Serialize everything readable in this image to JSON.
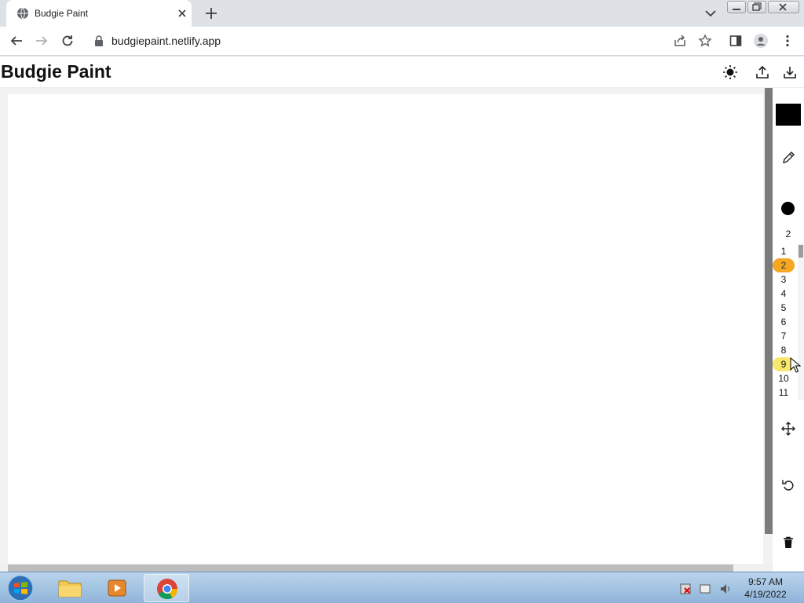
{
  "browser": {
    "tab_title": "Budgie Paint",
    "url": "budgiepaint.netlify.app"
  },
  "app": {
    "title": "Budgie Paint",
    "stroke_color": "#000000",
    "brush_size_value": "2",
    "brush_size_options": [
      "1",
      "2",
      "3",
      "4",
      "5",
      "6",
      "7",
      "8",
      "9",
      "10",
      "11"
    ],
    "selected_size": "2",
    "hovered_size": "9",
    "accent_selected": "#f5a623",
    "accent_hover": "#f7e86c"
  },
  "icons": {
    "theme": "sun-icon",
    "upload": "upload-icon",
    "download": "download-icon",
    "tool": "pencil-icon",
    "move": "move-icon",
    "undo": "undo-icon",
    "delete": "trash-icon"
  },
  "taskbar": {
    "time": "9:57 AM",
    "date": "4/19/2022"
  }
}
